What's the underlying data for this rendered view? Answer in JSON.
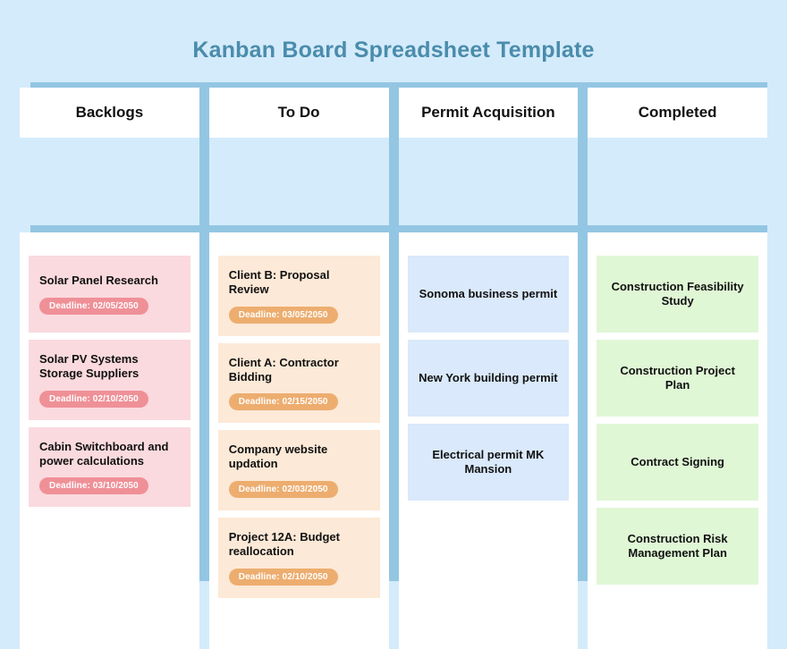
{
  "page": {
    "title": "Kanban Board Spreadsheet Template",
    "background_color": "#d4ebfb",
    "title_color": "#4a8cab",
    "rail_color": "#93c6e3"
  },
  "columns": [
    {
      "id": "backlogs",
      "header": "Backlogs",
      "card_style": "pink",
      "card_bg": "#fadade",
      "pill_bg": "#ef9097",
      "cards": [
        {
          "title": "Solar Panel Research",
          "deadline": "Deadline: 02/05/2050"
        },
        {
          "title": "Solar PV Systems Storage Suppliers",
          "deadline": "Deadline: 02/10/2050"
        },
        {
          "title": "Cabin Switchboard and power calculations",
          "deadline": "Deadline: 03/10/2050"
        }
      ]
    },
    {
      "id": "todo",
      "header": "To Do",
      "card_style": "peach",
      "card_bg": "#fce9d7",
      "pill_bg": "#edad6f",
      "cards": [
        {
          "title": "Client B: Proposal Review",
          "deadline": "Deadline: 03/05/2050"
        },
        {
          "title": "Client A: Contractor Bidding",
          "deadline": "Deadline: 02/15/2050"
        },
        {
          "title": "Company website updation",
          "deadline": "Deadline: 02/03/2050"
        },
        {
          "title": "Project 12A: Budget reallocation",
          "deadline": "Deadline: 02/10/2050"
        }
      ]
    },
    {
      "id": "permit-acquisition",
      "header": "Permit Acquisition",
      "card_style": "blue",
      "card_bg": "#dae9fb",
      "pill_bg": "",
      "cards": [
        {
          "title": "Sonoma business permit",
          "deadline": ""
        },
        {
          "title": "New York building permit",
          "deadline": ""
        },
        {
          "title": "Electrical permit MK Mansion",
          "deadline": ""
        }
      ]
    },
    {
      "id": "completed",
      "header": "Completed",
      "card_style": "green",
      "card_bg": "#e0f7d6",
      "pill_bg": "",
      "cards": [
        {
          "title": "Construction Feasibility Study",
          "deadline": ""
        },
        {
          "title": "Construction Project Plan",
          "deadline": ""
        },
        {
          "title": "Contract Signing",
          "deadline": ""
        },
        {
          "title": "Construction Risk Management Plan",
          "deadline": ""
        }
      ]
    }
  ]
}
